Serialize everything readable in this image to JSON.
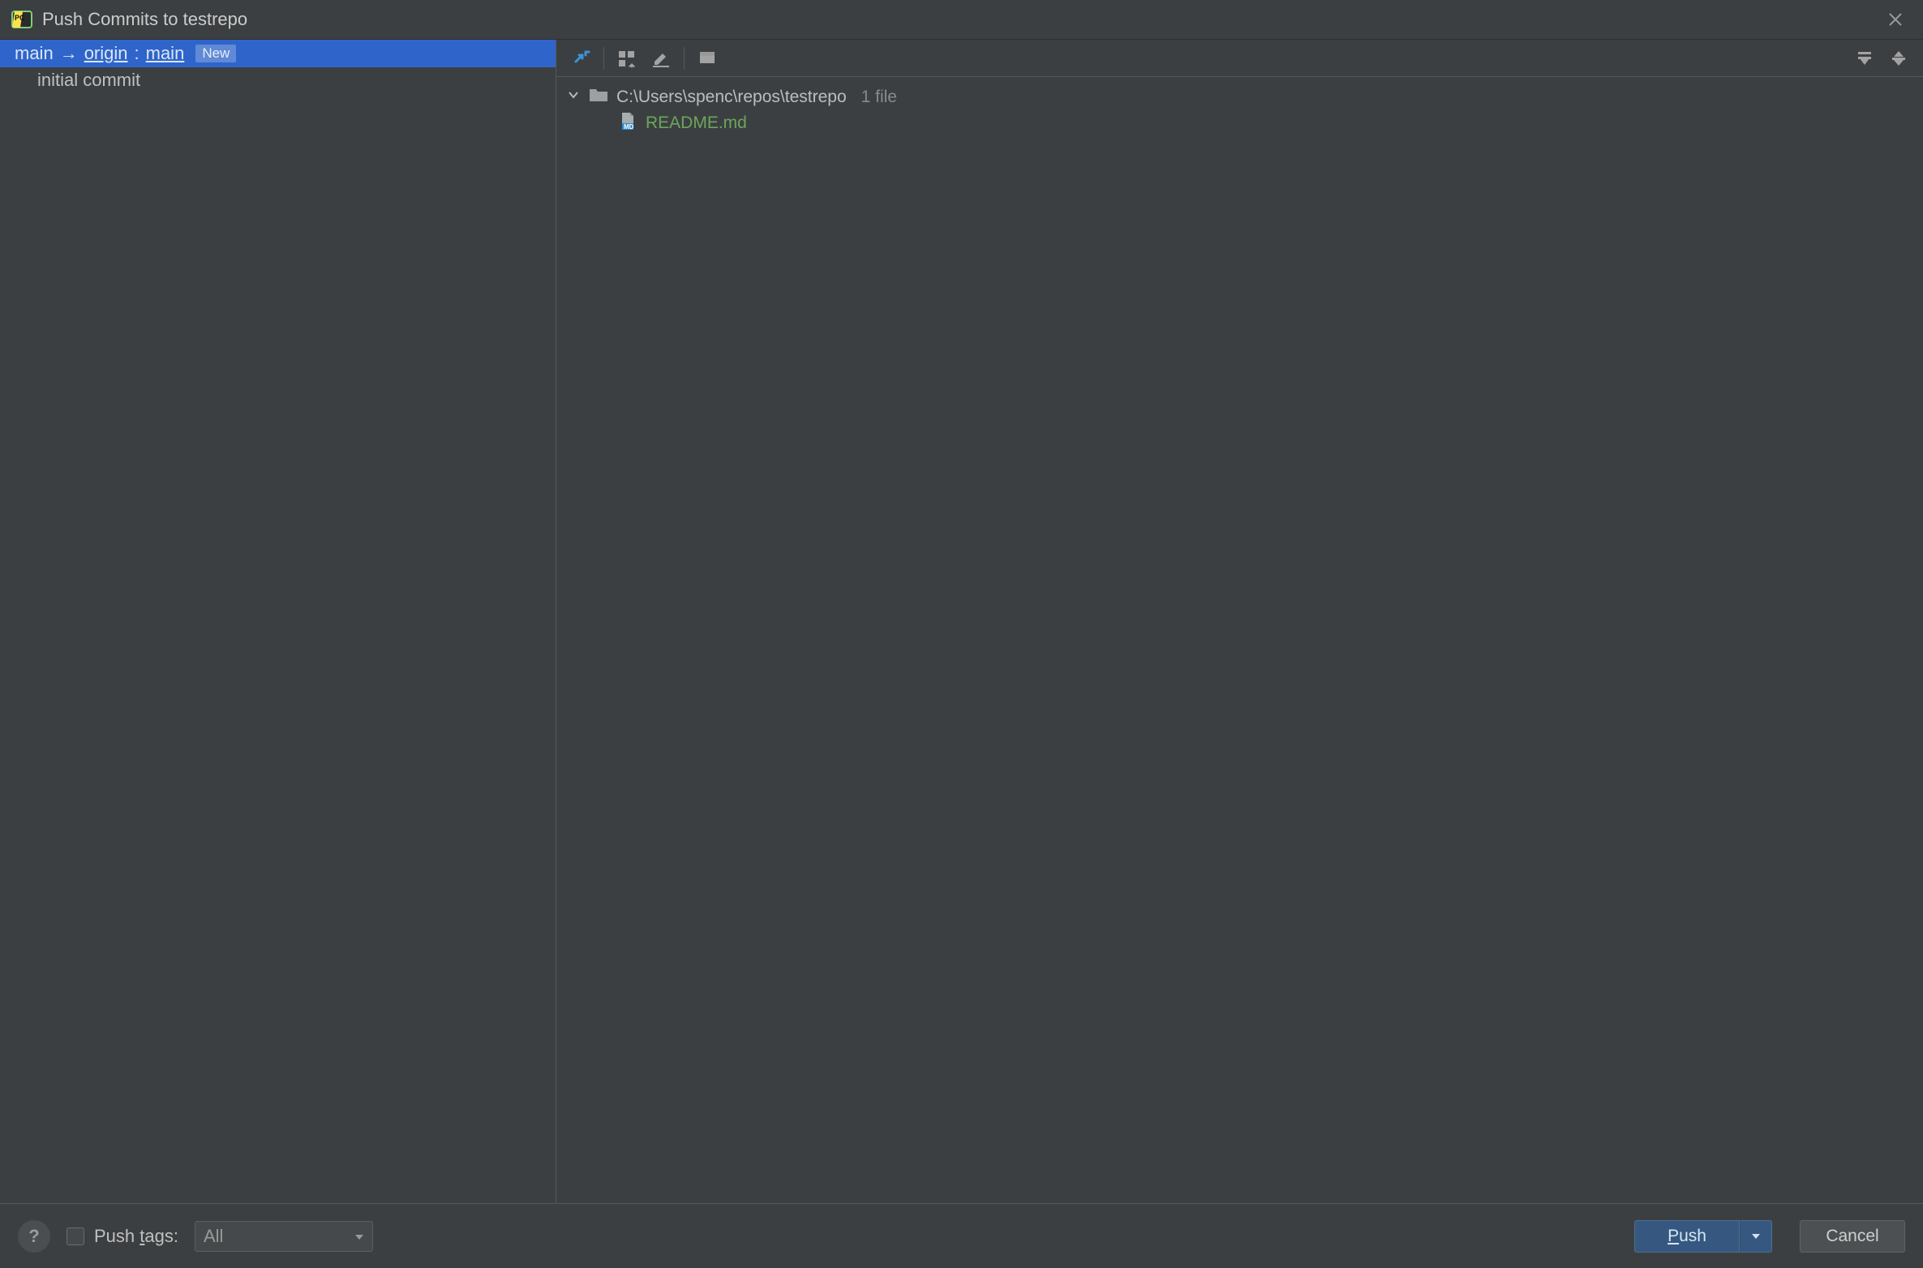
{
  "window": {
    "title": "Push Commits to testrepo"
  },
  "left": {
    "branch": {
      "local": "main",
      "arrow": "→",
      "remote": "origin",
      "colon": ":",
      "remote_branch": "main",
      "badge": "New"
    },
    "commits": [
      "initial commit"
    ]
  },
  "right": {
    "toolbar": {
      "show_diff": true,
      "group_by": true,
      "edit": true,
      "preview": true,
      "expand_all": true,
      "collapse_all": true
    },
    "tree": {
      "root_path": "C:\\Users\\spenc\\repos\\testrepo",
      "file_count": "1 file",
      "files": [
        {
          "name": "README.md",
          "type": "md"
        }
      ]
    }
  },
  "footer": {
    "push_tags_prefix": "Push ",
    "push_tags_underlined": "t",
    "push_tags_suffix": "ags:",
    "select_value": "All",
    "push_underlined": "P",
    "push_suffix": "ush",
    "cancel": "Cancel",
    "help": "?"
  }
}
